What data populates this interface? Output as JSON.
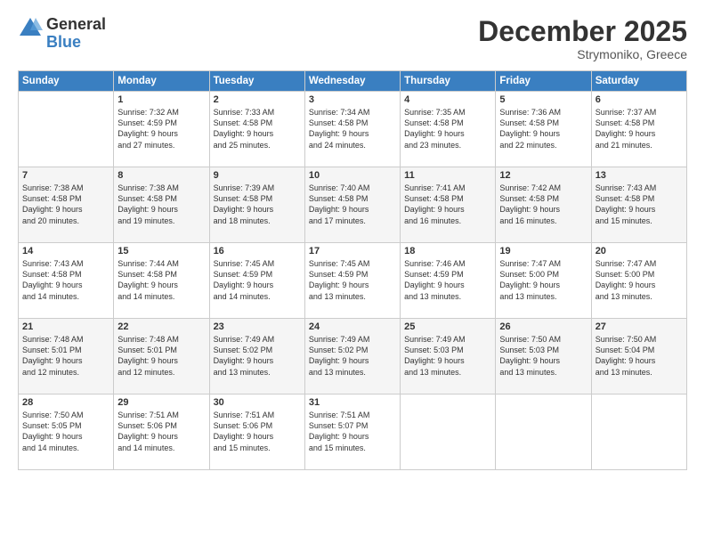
{
  "logo": {
    "general": "General",
    "blue": "Blue"
  },
  "header": {
    "month": "December 2025",
    "location": "Strymoniko, Greece"
  },
  "weekdays": [
    "Sunday",
    "Monday",
    "Tuesday",
    "Wednesday",
    "Thursday",
    "Friday",
    "Saturday"
  ],
  "weeks": [
    [
      {
        "day": "",
        "info": ""
      },
      {
        "day": "1",
        "info": "Sunrise: 7:32 AM\nSunset: 4:59 PM\nDaylight: 9 hours\nand 27 minutes."
      },
      {
        "day": "2",
        "info": "Sunrise: 7:33 AM\nSunset: 4:58 PM\nDaylight: 9 hours\nand 25 minutes."
      },
      {
        "day": "3",
        "info": "Sunrise: 7:34 AM\nSunset: 4:58 PM\nDaylight: 9 hours\nand 24 minutes."
      },
      {
        "day": "4",
        "info": "Sunrise: 7:35 AM\nSunset: 4:58 PM\nDaylight: 9 hours\nand 23 minutes."
      },
      {
        "day": "5",
        "info": "Sunrise: 7:36 AM\nSunset: 4:58 PM\nDaylight: 9 hours\nand 22 minutes."
      },
      {
        "day": "6",
        "info": "Sunrise: 7:37 AM\nSunset: 4:58 PM\nDaylight: 9 hours\nand 21 minutes."
      }
    ],
    [
      {
        "day": "7",
        "info": "Sunrise: 7:38 AM\nSunset: 4:58 PM\nDaylight: 9 hours\nand 20 minutes."
      },
      {
        "day": "8",
        "info": "Sunrise: 7:38 AM\nSunset: 4:58 PM\nDaylight: 9 hours\nand 19 minutes."
      },
      {
        "day": "9",
        "info": "Sunrise: 7:39 AM\nSunset: 4:58 PM\nDaylight: 9 hours\nand 18 minutes."
      },
      {
        "day": "10",
        "info": "Sunrise: 7:40 AM\nSunset: 4:58 PM\nDaylight: 9 hours\nand 17 minutes."
      },
      {
        "day": "11",
        "info": "Sunrise: 7:41 AM\nSunset: 4:58 PM\nDaylight: 9 hours\nand 16 minutes."
      },
      {
        "day": "12",
        "info": "Sunrise: 7:42 AM\nSunset: 4:58 PM\nDaylight: 9 hours\nand 16 minutes."
      },
      {
        "day": "13",
        "info": "Sunrise: 7:43 AM\nSunset: 4:58 PM\nDaylight: 9 hours\nand 15 minutes."
      }
    ],
    [
      {
        "day": "14",
        "info": "Sunrise: 7:43 AM\nSunset: 4:58 PM\nDaylight: 9 hours\nand 14 minutes."
      },
      {
        "day": "15",
        "info": "Sunrise: 7:44 AM\nSunset: 4:58 PM\nDaylight: 9 hours\nand 14 minutes."
      },
      {
        "day": "16",
        "info": "Sunrise: 7:45 AM\nSunset: 4:59 PM\nDaylight: 9 hours\nand 14 minutes."
      },
      {
        "day": "17",
        "info": "Sunrise: 7:45 AM\nSunset: 4:59 PM\nDaylight: 9 hours\nand 13 minutes."
      },
      {
        "day": "18",
        "info": "Sunrise: 7:46 AM\nSunset: 4:59 PM\nDaylight: 9 hours\nand 13 minutes."
      },
      {
        "day": "19",
        "info": "Sunrise: 7:47 AM\nSunset: 5:00 PM\nDaylight: 9 hours\nand 13 minutes."
      },
      {
        "day": "20",
        "info": "Sunrise: 7:47 AM\nSunset: 5:00 PM\nDaylight: 9 hours\nand 13 minutes."
      }
    ],
    [
      {
        "day": "21",
        "info": "Sunrise: 7:48 AM\nSunset: 5:01 PM\nDaylight: 9 hours\nand 12 minutes."
      },
      {
        "day": "22",
        "info": "Sunrise: 7:48 AM\nSunset: 5:01 PM\nDaylight: 9 hours\nand 12 minutes."
      },
      {
        "day": "23",
        "info": "Sunrise: 7:49 AM\nSunset: 5:02 PM\nDaylight: 9 hours\nand 13 minutes."
      },
      {
        "day": "24",
        "info": "Sunrise: 7:49 AM\nSunset: 5:02 PM\nDaylight: 9 hours\nand 13 minutes."
      },
      {
        "day": "25",
        "info": "Sunrise: 7:49 AM\nSunset: 5:03 PM\nDaylight: 9 hours\nand 13 minutes."
      },
      {
        "day": "26",
        "info": "Sunrise: 7:50 AM\nSunset: 5:03 PM\nDaylight: 9 hours\nand 13 minutes."
      },
      {
        "day": "27",
        "info": "Sunrise: 7:50 AM\nSunset: 5:04 PM\nDaylight: 9 hours\nand 13 minutes."
      }
    ],
    [
      {
        "day": "28",
        "info": "Sunrise: 7:50 AM\nSunset: 5:05 PM\nDaylight: 9 hours\nand 14 minutes."
      },
      {
        "day": "29",
        "info": "Sunrise: 7:51 AM\nSunset: 5:06 PM\nDaylight: 9 hours\nand 14 minutes."
      },
      {
        "day": "30",
        "info": "Sunrise: 7:51 AM\nSunset: 5:06 PM\nDaylight: 9 hours\nand 15 minutes."
      },
      {
        "day": "31",
        "info": "Sunrise: 7:51 AM\nSunset: 5:07 PM\nDaylight: 9 hours\nand 15 minutes."
      },
      {
        "day": "",
        "info": ""
      },
      {
        "day": "",
        "info": ""
      },
      {
        "day": "",
        "info": ""
      }
    ]
  ]
}
